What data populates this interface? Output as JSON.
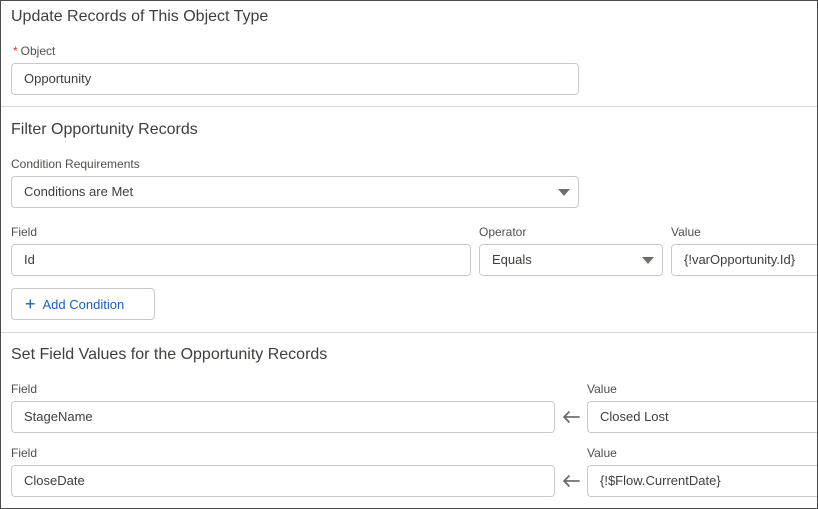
{
  "section1": {
    "title": "Update Records of This Object Type",
    "object_required_marker": "*",
    "object_label": "Object",
    "object_value": "Opportunity"
  },
  "section2": {
    "title": "Filter Opportunity Records",
    "condition_label": "Condition Requirements",
    "condition_value": "Conditions are Met",
    "field_label": "Field",
    "operator_label": "Operator",
    "value_label": "Value",
    "field_value": "Id",
    "operator_value": "Equals",
    "value_value": "{!varOpportunity.Id}",
    "add_condition_label": "Add Condition"
  },
  "section3": {
    "title": "Set Field Values for the Opportunity Records",
    "rows": [
      {
        "field_label": "Field",
        "value_label": "Value",
        "field_value": "StageName",
        "value_value": "Closed Lost"
      },
      {
        "field_label": "Field",
        "value_label": "Value",
        "field_value": "CloseDate",
        "value_value": "{!$Flow.CurrentDate}"
      }
    ]
  }
}
